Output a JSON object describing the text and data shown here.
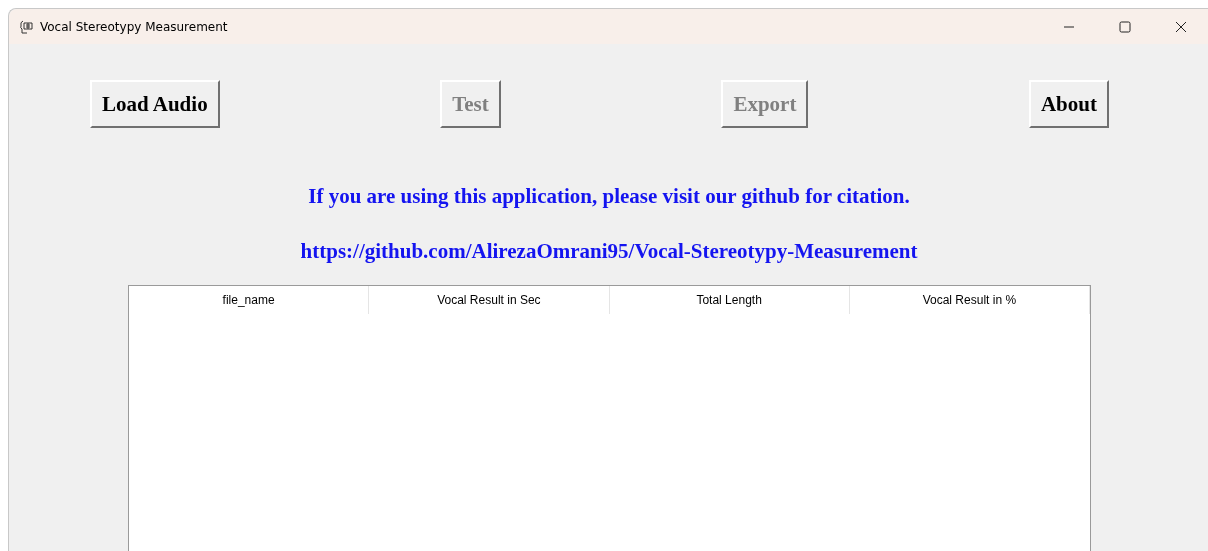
{
  "window": {
    "title": "Vocal Stereotypy Measurement"
  },
  "buttons": [
    {
      "label": "Load Audio",
      "disabled": false
    },
    {
      "label": "Test",
      "disabled": true
    },
    {
      "label": "Export",
      "disabled": true
    },
    {
      "label": "About",
      "disabled": false
    }
  ],
  "notice": "If you are using this application, please visit our github for citation.",
  "link": "https://github.com/AlirezaOmrani95/Vocal-Stereotypy-Measurement",
  "table": {
    "columns": [
      "file_name",
      "Vocal Result in Sec",
      "Total Length",
      "Vocal Result in %"
    ]
  }
}
